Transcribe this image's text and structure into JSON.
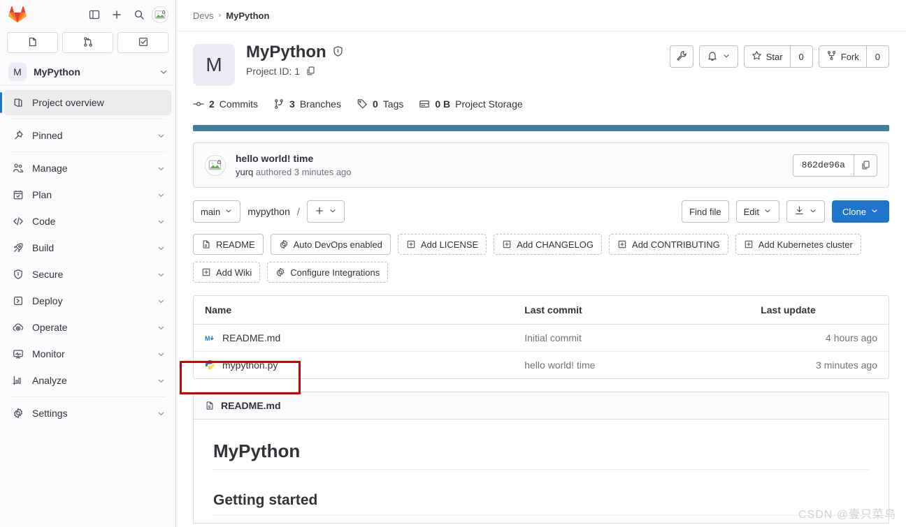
{
  "browser": {
    "toolbar_icons": [
      "sidebar-toggle-icon",
      "new-tab-icon",
      "search-icon",
      "profile-avatar-icon"
    ]
  },
  "sidebar": {
    "logo": "gitlab-logo",
    "shortcuts": [
      {
        "name": "issues-shortcut",
        "icon": "issues-icon"
      },
      {
        "name": "merge-requests-shortcut",
        "icon": "merge-request-icon"
      },
      {
        "name": "todo-list-shortcut",
        "icon": "todo-check-icon"
      }
    ],
    "project": {
      "initial": "M",
      "name": "MyPython"
    },
    "items": [
      {
        "label": "Project overview",
        "icon": "project-icon",
        "active": true,
        "expandable": false
      },
      {
        "label": "Pinned",
        "icon": "pin-icon",
        "active": false,
        "expandable": true
      },
      {
        "label": "Manage",
        "icon": "users-icon",
        "active": false,
        "expandable": true
      },
      {
        "label": "Plan",
        "icon": "calendar-icon",
        "active": false,
        "expandable": true
      },
      {
        "label": "Code",
        "icon": "code-icon",
        "active": false,
        "expandable": true
      },
      {
        "label": "Build",
        "icon": "rocket-icon",
        "active": false,
        "expandable": true
      },
      {
        "label": "Secure",
        "icon": "shield-icon",
        "active": false,
        "expandable": true
      },
      {
        "label": "Deploy",
        "icon": "deploy-icon",
        "active": false,
        "expandable": true
      },
      {
        "label": "Operate",
        "icon": "cloud-gear-icon",
        "active": false,
        "expandable": true
      },
      {
        "label": "Monitor",
        "icon": "monitor-icon",
        "active": false,
        "expandable": true
      },
      {
        "label": "Analyze",
        "icon": "chart-icon",
        "active": false,
        "expandable": true
      },
      {
        "label": "Settings",
        "icon": "gear-icon",
        "active": false,
        "expandable": true
      }
    ]
  },
  "breadcrumb": {
    "group": "Devs",
    "separator": "›",
    "project": "MyPython"
  },
  "project": {
    "initial": "M",
    "title": "MyPython",
    "visibility_icon": "shield-private-icon",
    "id_label": "Project ID: 1",
    "copy_icon": "copy-icon",
    "stats": [
      {
        "icon": "commit-icon",
        "value": "2",
        "label": "Commits"
      },
      {
        "icon": "branch-icon",
        "value": "3",
        "label": "Branches"
      },
      {
        "icon": "tag-icon",
        "value": "0",
        "label": "Tags"
      },
      {
        "icon": "storage-icon",
        "value": "0 B",
        "label": "Project Storage"
      }
    ],
    "actions": {
      "wrench_icon": "wrench-icon",
      "notification_icon": "bell-icon",
      "star_label": "Star",
      "star_count": "0",
      "fork_label": "Fork",
      "fork_count": "0"
    },
    "language_bar_color": "#3f7e9d"
  },
  "commit": {
    "title": "hello world! time",
    "author": "yurq",
    "meta": "authored 3 minutes ago",
    "sha": "862de96a",
    "copy_icon": "copy-icon"
  },
  "repo_toolbar": {
    "branch": "main",
    "path": "mypython",
    "path_separator": "/",
    "add_label": "+",
    "find_file": "Find file",
    "edit": "Edit",
    "download_icon": "download-icon",
    "clone": "Clone"
  },
  "quick_actions": [
    {
      "label": "README",
      "icon": "doc-icon",
      "dashed": false
    },
    {
      "label": "Auto DevOps enabled",
      "icon": "gear-icon",
      "dashed": false
    },
    {
      "label": "Add LICENSE",
      "icon": "plus-square-icon",
      "dashed": true
    },
    {
      "label": "Add CHANGELOG",
      "icon": "plus-square-icon",
      "dashed": true
    },
    {
      "label": "Add CONTRIBUTING",
      "icon": "plus-square-icon",
      "dashed": true
    },
    {
      "label": "Add Kubernetes cluster",
      "icon": "plus-square-icon",
      "dashed": true
    },
    {
      "label": "Add Wiki",
      "icon": "plus-square-icon",
      "dashed": true
    },
    {
      "label": "Configure Integrations",
      "icon": "gear-icon",
      "dashed": true
    }
  ],
  "files": {
    "headers": {
      "name": "Name",
      "last_commit": "Last commit",
      "last_update": "Last update"
    },
    "rows": [
      {
        "name": "README.md",
        "icon": "markdown-icon",
        "last_commit": "Initial commit",
        "last_update": "4 hours ago",
        "highlighted": false
      },
      {
        "name": "mypython.py",
        "icon": "python-icon",
        "last_commit": "hello world! time",
        "last_update": "3 minutes ago",
        "highlighted": true
      }
    ]
  },
  "readme": {
    "filename": "README.md",
    "file_icon": "doc-icon",
    "h1": "MyPython",
    "h2": "Getting started"
  },
  "watermark": "CSDN @壹只菜鸟",
  "colors": {
    "primary": "#1f75cb",
    "annotation": "#cc0000",
    "language_bar": "#3f7e9d"
  }
}
